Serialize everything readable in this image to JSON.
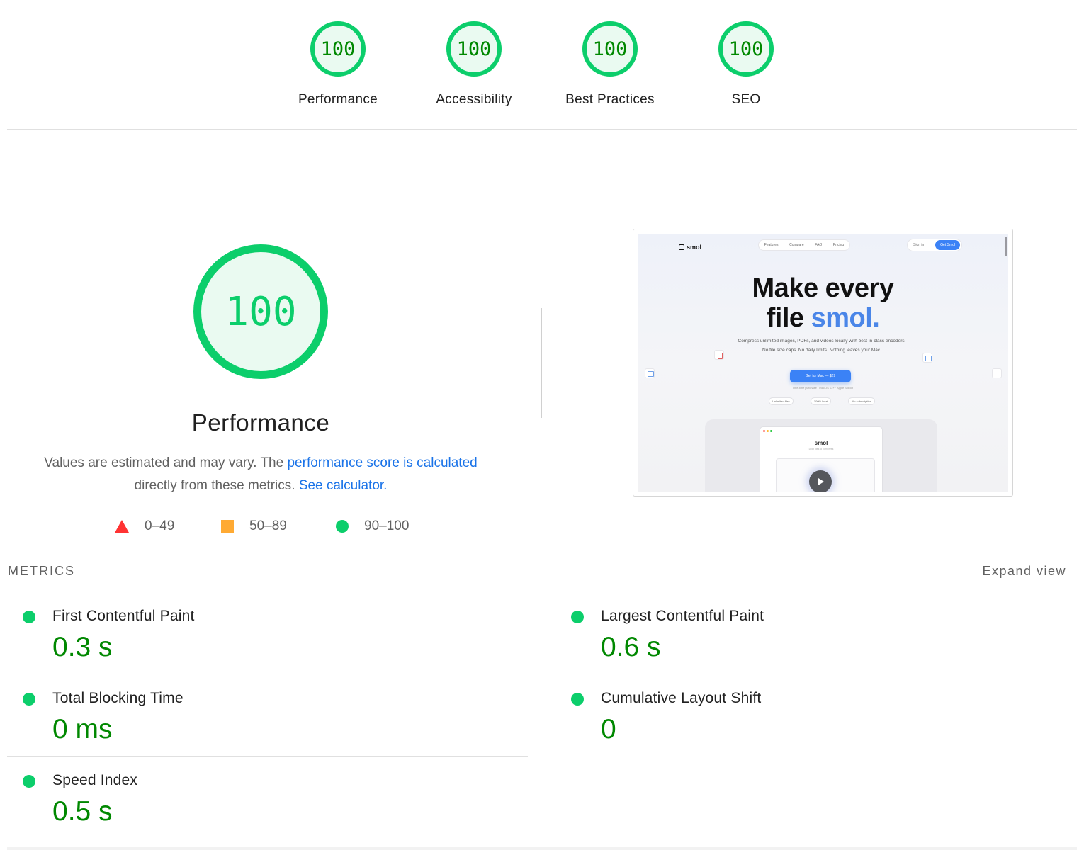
{
  "gauges": [
    {
      "score": "100",
      "label": "Performance"
    },
    {
      "score": "100",
      "label": "Accessibility"
    },
    {
      "score": "100",
      "label": "Best Practices"
    },
    {
      "score": "100",
      "label": "SEO"
    }
  ],
  "main": {
    "score": "100",
    "title": "Performance",
    "description": {
      "text1": "Values are estimated and may vary. The ",
      "link1": "performance score is calculated",
      "text2": " directly from these metrics. ",
      "link2": "See calculator.",
      "link_color": "#1a73e8"
    },
    "legend": [
      {
        "shape": "triangle",
        "range": "0–49",
        "color": "#ff3333"
      },
      {
        "shape": "square",
        "range": "50–89",
        "color": "#ffaa33"
      },
      {
        "shape": "circle",
        "range": "90–100",
        "color": "#0cce6b"
      }
    ]
  },
  "preview": {
    "logo": "smol",
    "nav": [
      "Features",
      "Compare",
      "FAQ",
      "Pricing"
    ],
    "sign_in": "Sign in",
    "cta": "Get Smol",
    "headline_line1": "Make every",
    "headline_line2_pre": "file ",
    "headline_line2_accent": "smol.",
    "subtext": "Compress unlimited images, PDFs, and videos locally with best-in-class encoders. No file size caps. No daily limits. Nothing leaves your Mac.",
    "button": "Get for Mac — $29",
    "note": "One-time purchase · macOS 13+ · Apple Silicon",
    "pills": [
      "Unlimited files",
      "100% local",
      "No subscription"
    ],
    "window_title": "smol",
    "window_subtitle": "Drop files to compress"
  },
  "metrics": {
    "heading": "METRICS",
    "expand_label": "Expand view",
    "items": [
      {
        "title": "First Contentful Paint",
        "value": "0.3 s"
      },
      {
        "title": "Largest Contentful Paint",
        "value": "0.6 s"
      },
      {
        "title": "Total Blocking Time",
        "value": "0 ms"
      },
      {
        "title": "Cumulative Layout Shift",
        "value": "0"
      },
      {
        "title": "Speed Index",
        "value": "0.5 s"
      }
    ]
  },
  "colors": {
    "pass": "#0cce6b",
    "pass_text": "#008800",
    "pass_bg": "#eafaf1"
  }
}
